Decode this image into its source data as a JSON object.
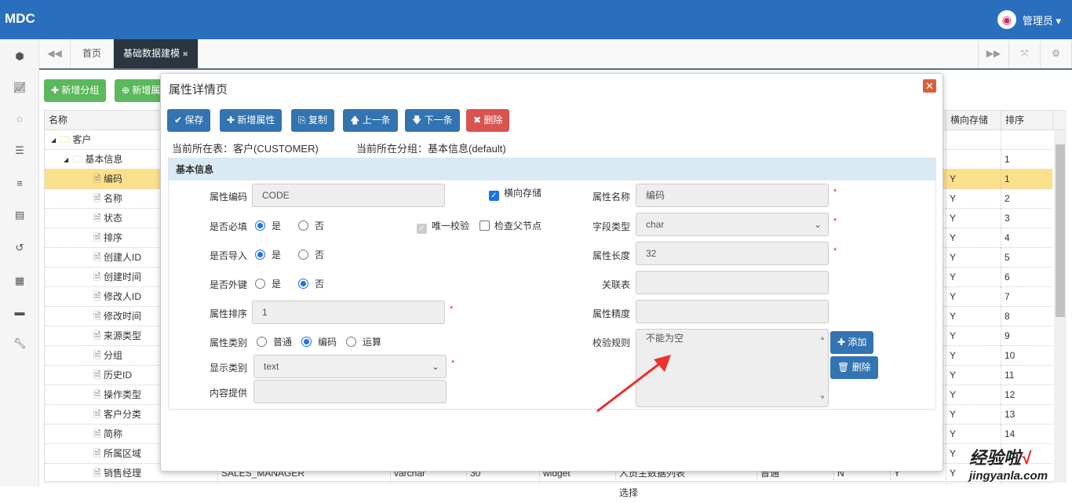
{
  "header": {
    "logo": "MDC",
    "user": "管理员 ▾",
    "brand_color": "#2a6fbd"
  },
  "sidebar": {
    "icons": [
      "cube-icon",
      "chart-line-icon",
      "spinner-icon",
      "database-icon",
      "list-icon",
      "card-icon",
      "history-icon",
      "film-icon",
      "archive-icon",
      "wrench-icon"
    ]
  },
  "tabs": {
    "home": "首页",
    "active": "基础数据建模",
    "close": "✖"
  },
  "toolbar": {
    "add_group": "新增分组",
    "add_attr": "新增属"
  },
  "grid": {
    "headers": {
      "name": "名称",
      "horizontal": "横向存储",
      "sort": "排序"
    },
    "rows": [
      {
        "name": "客户",
        "level": 0,
        "type": "folder",
        "h": "",
        "s": ""
      },
      {
        "name": "基本信息",
        "level": 1,
        "type": "folder",
        "h": "",
        "s": "1"
      },
      {
        "name": "编码",
        "level": 2,
        "type": "file",
        "h": "Y",
        "s": "1",
        "selected": true
      },
      {
        "name": "名称",
        "level": 2,
        "type": "file",
        "h": "Y",
        "s": "2"
      },
      {
        "name": "状态",
        "level": 2,
        "type": "file",
        "h": "Y",
        "s": "3"
      },
      {
        "name": "排序",
        "level": 2,
        "type": "file",
        "h": "Y",
        "s": "4"
      },
      {
        "name": "创建人ID",
        "level": 2,
        "type": "file",
        "h": "Y",
        "s": "5"
      },
      {
        "name": "创建时间",
        "level": 2,
        "type": "file",
        "h": "Y",
        "s": "6"
      },
      {
        "name": "修改人ID",
        "level": 2,
        "type": "file",
        "h": "Y",
        "s": "7"
      },
      {
        "name": "修改时间",
        "level": 2,
        "type": "file",
        "h": "Y",
        "s": "8"
      },
      {
        "name": "来源类型",
        "level": 2,
        "type": "file",
        "h": "Y",
        "s": "9"
      },
      {
        "name": "分组",
        "level": 2,
        "type": "file",
        "h": "Y",
        "s": "10"
      },
      {
        "name": "历史ID",
        "level": 2,
        "type": "file",
        "h": "Y",
        "s": "11"
      },
      {
        "name": "操作类型",
        "level": 2,
        "type": "file",
        "h": "Y",
        "s": "12"
      },
      {
        "name": "客户分类",
        "level": 2,
        "type": "file",
        "h": "Y",
        "s": "13"
      },
      {
        "name": "简称",
        "level": 2,
        "type": "file",
        "h": "Y",
        "s": "14"
      },
      {
        "name": "所属区域",
        "level": 2,
        "type": "file",
        "h": "Y",
        "s": ""
      },
      {
        "name": "销售经理",
        "level": 2,
        "type": "file",
        "h": "Y",
        "s": ""
      }
    ],
    "last_row_cells": [
      "SALES_MANAGER",
      "varchar",
      "30",
      "widget",
      "人员主数据列表选择",
      "普通",
      "N",
      "Y"
    ]
  },
  "modal": {
    "title": "属性详情页",
    "buttons": {
      "save": "✔ 保存",
      "add": "✚ 新增属性",
      "copy": "复制",
      "prev": "🡅 上一条",
      "next": "🡇 下一条",
      "delete": "✖ 删除"
    },
    "current_table": "当前所在表：客户(CUSTOMER)",
    "current_group": "当前所在分组：基本信息(default)",
    "section": "基本信息",
    "fields": {
      "code_label": "属性编码",
      "code": "CODE",
      "horizontal_label": "横向存储",
      "required_label": "是否必填",
      "import_label": "是否导入",
      "fk_label": "是否外键",
      "yes": "是",
      "no": "否",
      "unique_label": "唯一校验",
      "check_parent_label": "检查父节点",
      "order_label": "属性排序",
      "order": "1",
      "category_label": "属性类别",
      "cat_normal": "普通",
      "cat_code": "编码",
      "cat_calc": "运算",
      "display_label": "显示类别",
      "display": "text",
      "content_label": "内容提供",
      "content": "",
      "name_label": "属性名称",
      "name": "编码",
      "fieldtype_label": "字段类型",
      "fieldtype": "char",
      "length_label": "属性长度",
      "length": "32",
      "ref_label": "关联表",
      "ref": "",
      "precision_label": "属性精度",
      "precision": "",
      "rule_label": "校验规则",
      "rule": "不能为空",
      "add_rule": "✚ 添加",
      "del_rule": "删除",
      "req_mark": "*"
    }
  },
  "watermark": {
    "text": "经验啦",
    "url": "jingyanla.com",
    "check": "√"
  }
}
